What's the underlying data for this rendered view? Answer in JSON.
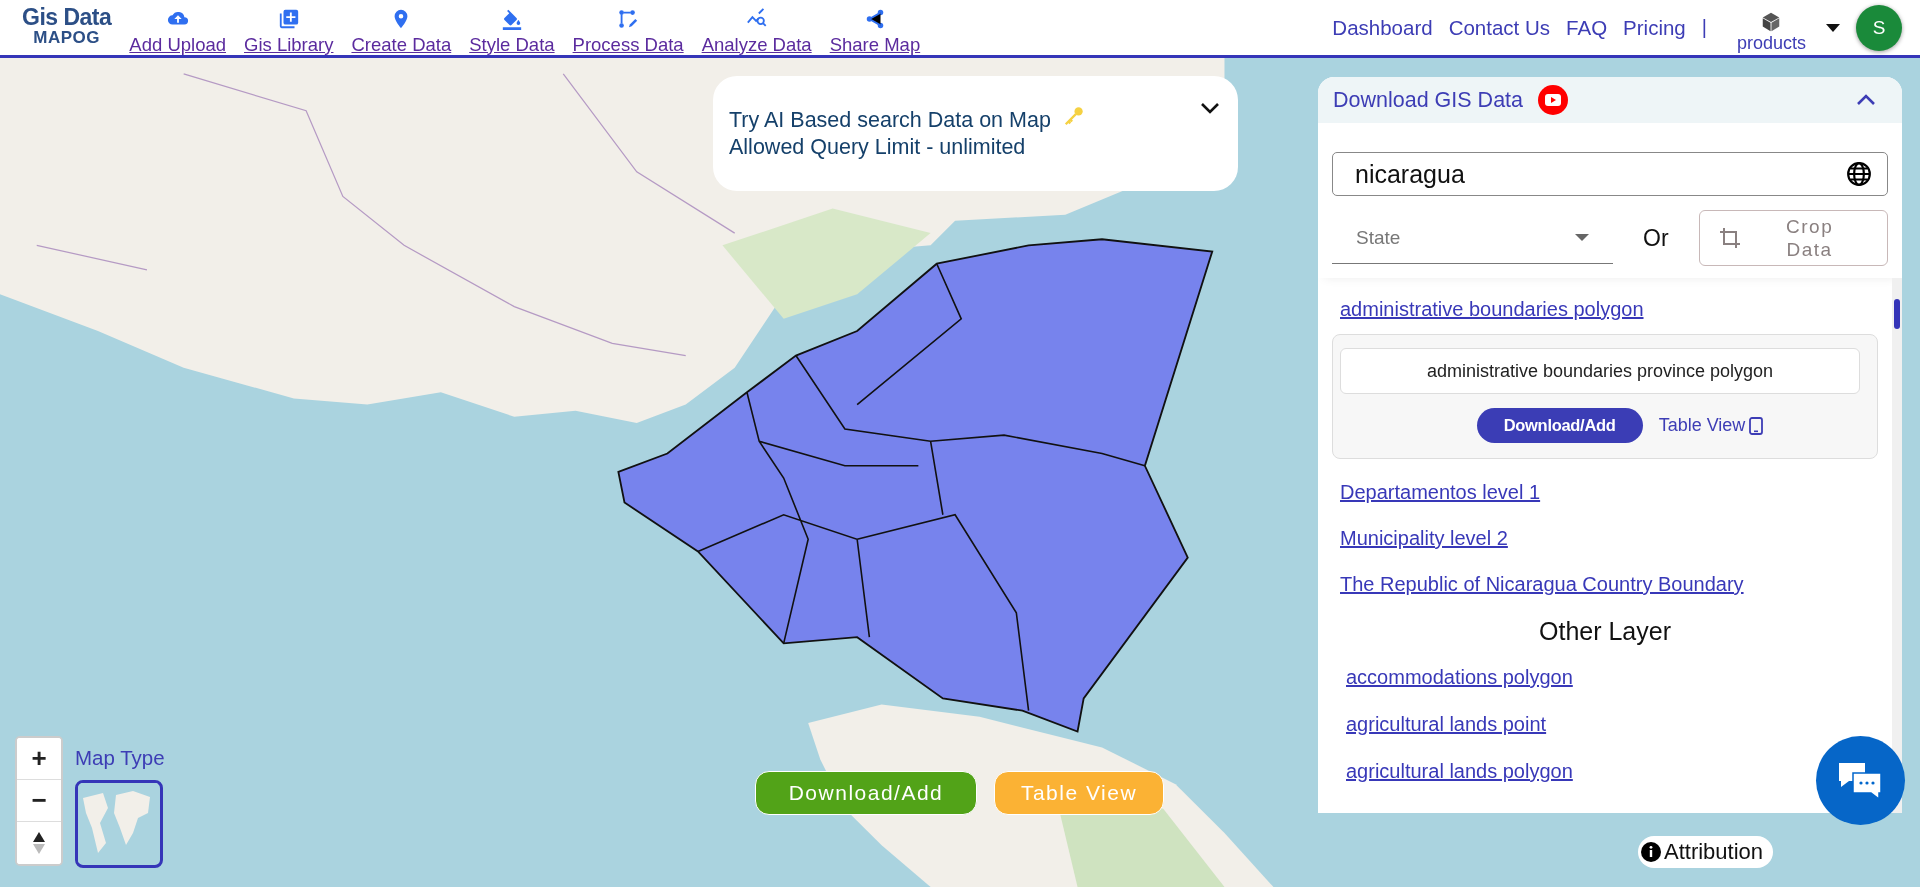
{
  "header": {
    "logo": {
      "line1": "Gis Data",
      "line2": "MAPOG"
    },
    "nav": [
      {
        "label": "Add Upload"
      },
      {
        "label": "Gis Library"
      },
      {
        "label": "Create Data"
      },
      {
        "label": "Style Data"
      },
      {
        "label": "Process Data"
      },
      {
        "label": "Analyze Data"
      },
      {
        "label": "Share Map"
      }
    ],
    "links": [
      {
        "label": "Dashboard"
      },
      {
        "label": "Contact Us"
      },
      {
        "label": "FAQ"
      },
      {
        "label": "Pricing"
      }
    ],
    "separator": "|",
    "products": "products",
    "avatar": "S"
  },
  "ai_search": {
    "line1": "Try AI Based search Data on Map",
    "line2": "Allowed Query Limit - unlimited"
  },
  "panel": {
    "title": "Download GIS Data",
    "search": {
      "value": "nicaragua"
    },
    "state": {
      "placeholder": "State"
    },
    "or": "Or",
    "crop": "Crop Data",
    "layers": [
      {
        "label": "administrative boundaries polygon",
        "card": {
          "title": "administrative boundaries province polygon",
          "download": "Download/Add",
          "table_view": "Table View"
        }
      },
      {
        "label": "Departamentos level 1"
      },
      {
        "label": "Municipality level 2"
      },
      {
        "label": "The Republic of Nicaragua Country Boundary"
      }
    ],
    "other_heading": "Other Layer",
    "other_layers": [
      {
        "label": "accommodations polygon"
      },
      {
        "label": "agricultural lands point"
      },
      {
        "label": "agricultural lands polygon"
      }
    ]
  },
  "map": {
    "zoom_in": "+",
    "zoom_out": "−",
    "map_type": "Map Type"
  },
  "actions": {
    "download": "Download/Add",
    "table_view": "Table View"
  },
  "attribution": "Attribution"
}
